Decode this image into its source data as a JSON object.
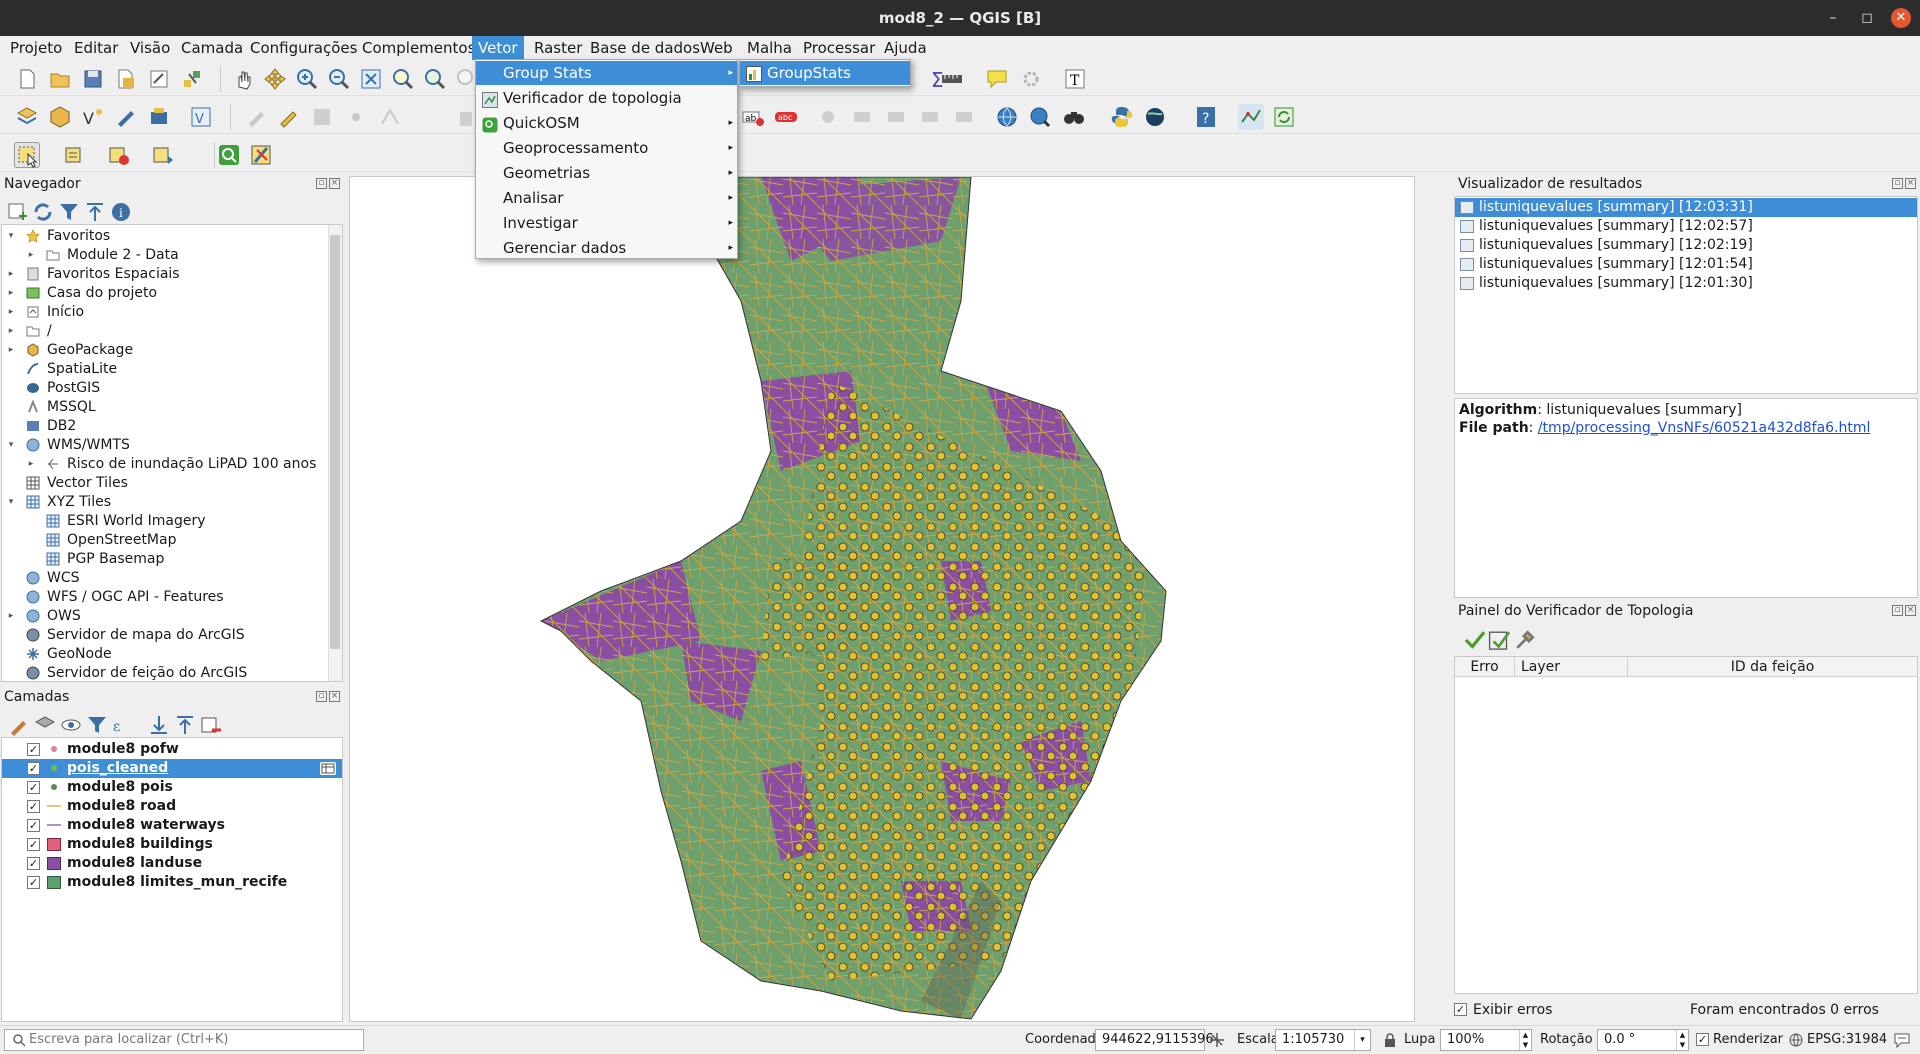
{
  "window": {
    "title": "mod8_2 — QGIS [B]",
    "minimize": "–",
    "maximize": "◻",
    "close": "✕"
  },
  "menubar": [
    {
      "label": "Projeto"
    },
    {
      "label": "Editar"
    },
    {
      "label": "Visão"
    },
    {
      "label": "Camada"
    },
    {
      "label": "Configurações"
    },
    {
      "label": "Complementos"
    },
    {
      "label": "Vetor"
    },
    {
      "label": "Raster"
    },
    {
      "label": "Base de dados"
    },
    {
      "label": "Web"
    },
    {
      "label": "Malha"
    },
    {
      "label": "Processar"
    },
    {
      "label": "Ajuda"
    }
  ],
  "vector_menu": {
    "items": [
      {
        "label": "Group Stats",
        "submenu": true
      },
      {
        "label": "Verificador de topologia",
        "submenu": false
      },
      {
        "label": "QuickOSM",
        "submenu": true
      },
      {
        "label": "Geoprocessamento",
        "submenu": true
      },
      {
        "label": "Geometrias",
        "submenu": true
      },
      {
        "label": "Analisar",
        "submenu": true
      },
      {
        "label": "Investigar",
        "submenu": true
      },
      {
        "label": "Gerenciar dados",
        "submenu": true
      }
    ],
    "arrow": "▸"
  },
  "groupstats_submenu": {
    "items": [
      {
        "label": "GroupStats"
      }
    ]
  },
  "navigator": {
    "title": "Navegador",
    "items": [
      {
        "label": "Favoritos",
        "expander": "▾",
        "icon": "star-icon"
      },
      {
        "label": "Module 2 - Data",
        "expander": "▸",
        "icon": "folder-icon"
      },
      {
        "label": "Favoritos Espaciais",
        "expander": "▸",
        "icon": "spatial-bookmark-icon"
      },
      {
        "label": "Casa do projeto",
        "expander": "▸",
        "icon": "project-home-icon"
      },
      {
        "label": "Início",
        "expander": "▸",
        "icon": "home-folder-icon"
      },
      {
        "label": "/",
        "expander": "▸",
        "icon": "root-folder-icon"
      },
      {
        "label": "GeoPackage",
        "expander": "▸",
        "icon": "geopackage-icon"
      },
      {
        "label": "SpatiaLite",
        "expander": "",
        "icon": "spatialite-icon"
      },
      {
        "label": "PostGIS",
        "expander": "",
        "icon": "postgis-icon"
      },
      {
        "label": "MSSQL",
        "expander": "",
        "icon": "mssql-icon"
      },
      {
        "label": "DB2",
        "expander": "",
        "icon": "db2-icon"
      },
      {
        "label": "WMS/WMTS",
        "expander": "▾",
        "icon": "wms-icon"
      },
      {
        "label": "Risco de inundação LiPAD 100 anos",
        "expander": "▸",
        "icon": "wms-layer-icon"
      },
      {
        "label": "Vector Tiles",
        "expander": "",
        "icon": "vector-tiles-icon"
      },
      {
        "label": "XYZ Tiles",
        "expander": "▾",
        "icon": "xyz-tiles-icon"
      },
      {
        "label": "ESRI World Imagery",
        "expander": "",
        "icon": "xyz-layer-icon"
      },
      {
        "label": "OpenStreetMap",
        "expander": "",
        "icon": "xyz-layer-icon"
      },
      {
        "label": "PGP Basemap",
        "expander": "",
        "icon": "xyz-layer-icon"
      },
      {
        "label": "WCS",
        "expander": "",
        "icon": "wcs-icon"
      },
      {
        "label": "WFS / OGC API - Features",
        "expander": "",
        "icon": "wfs-icon"
      },
      {
        "label": "OWS",
        "expander": "▸",
        "icon": "ows-icon"
      },
      {
        "label": "Servidor de mapa do ArcGIS",
        "expander": "",
        "icon": "arcgis-map-icon"
      },
      {
        "label": "GeoNode",
        "expander": "",
        "icon": "geonode-icon"
      },
      {
        "label": "Servidor de feição do ArcGIS",
        "expander": "",
        "icon": "arcgis-feature-icon"
      }
    ]
  },
  "layers": {
    "title": "Camadas",
    "items": [
      {
        "label": "module8 pofw",
        "checked": "✓",
        "color": "#e07fa6"
      },
      {
        "label": "pois_cleaned",
        "checked": "✓",
        "color": "#6fbf59"
      },
      {
        "label": "module8 pois",
        "checked": "✓",
        "color": "#5f8a55"
      },
      {
        "label": "module8 road",
        "checked": "✓",
        "color": "#d4b35a"
      },
      {
        "label": "module8 waterways",
        "checked": "✓",
        "color": "#8a6fb8"
      },
      {
        "label": "module8 buildings",
        "checked": "✓",
        "color": "#e0607e"
      },
      {
        "label": "module8 landuse",
        "checked": "✓",
        "color": "#8a4fa3"
      },
      {
        "label": "module8 limites_mun_recife",
        "checked": "✓",
        "color": "#5f9e6e"
      }
    ]
  },
  "results_viewer": {
    "title": "Visualizador de resultados",
    "items": [
      {
        "label": "listuniquevalues [summary] [12:03:31]"
      },
      {
        "label": "listuniquevalues [summary] [12:02:57]"
      },
      {
        "label": "listuniquevalues [summary] [12:02:19]"
      },
      {
        "label": "listuniquevalues [summary] [12:01:54]"
      },
      {
        "label": "listuniquevalues [summary] [12:01:30]"
      }
    ],
    "algorithm_label": "Algorithm",
    "algorithm_value": ": listuniquevalues [summary]",
    "filepath_label": "File path",
    "filepath_sep": ": ",
    "filepath_value": "/tmp/processing_VnsNFs/60521a432d8fa6.html"
  },
  "topology_panel": {
    "title": "Painel do Verificador de Topologia",
    "columns": [
      "Erro",
      "Layer",
      "ID da feição"
    ],
    "show_errors_label": "Exibir erros",
    "show_errors_check": "✓",
    "found_label": "Foram encontrados 0 erros"
  },
  "statusbar": {
    "search_placeholder": "Escreva para localizar (Ctrl+K)",
    "coord_label": "Coordenada",
    "coord_value": "944622,9115396",
    "scale_label": "Escala",
    "scale_value": "1:105730",
    "magnifier_label": "Lupa",
    "magnifier_value": "100%",
    "rotation_label": "Rotação",
    "rotation_value": "0.0 °",
    "render_label": "Renderizar",
    "render_check": "✓",
    "crs_label": "EPSG:31984"
  },
  "colors": {
    "accent": "#3d8ed6",
    "limits": "#5f9e6e",
    "landuse": "#8a4fa3",
    "roads": "#c9a646",
    "pois": "#e6c229"
  }
}
